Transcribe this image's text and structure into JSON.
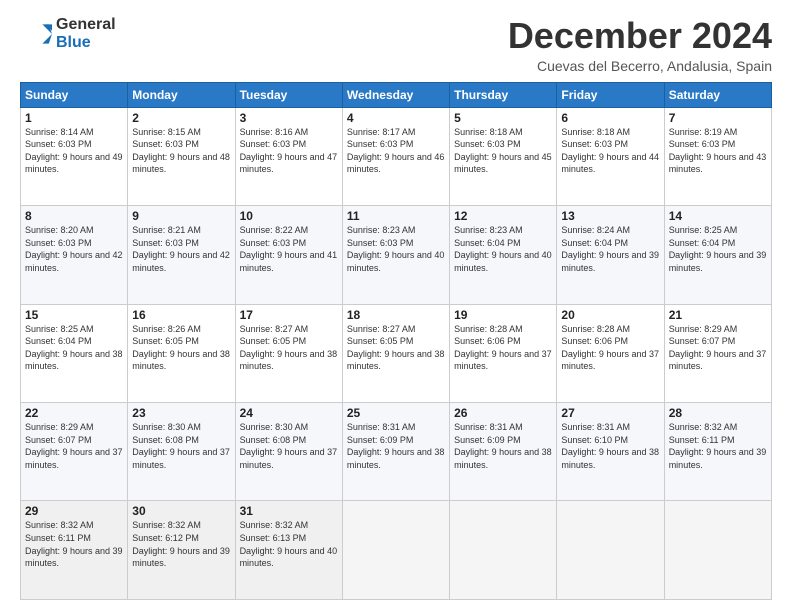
{
  "logo": {
    "general": "General",
    "blue": "Blue"
  },
  "title": "December 2024",
  "subtitle": "Cuevas del Becerro, Andalusia, Spain",
  "days_header": [
    "Sunday",
    "Monday",
    "Tuesday",
    "Wednesday",
    "Thursday",
    "Friday",
    "Saturday"
  ],
  "weeks": [
    [
      {
        "day": "1",
        "sunrise": "8:14 AM",
        "sunset": "6:03 PM",
        "daylight": "9 hours and 49 minutes."
      },
      {
        "day": "2",
        "sunrise": "8:15 AM",
        "sunset": "6:03 PM",
        "daylight": "9 hours and 48 minutes."
      },
      {
        "day": "3",
        "sunrise": "8:16 AM",
        "sunset": "6:03 PM",
        "daylight": "9 hours and 47 minutes."
      },
      {
        "day": "4",
        "sunrise": "8:17 AM",
        "sunset": "6:03 PM",
        "daylight": "9 hours and 46 minutes."
      },
      {
        "day": "5",
        "sunrise": "8:18 AM",
        "sunset": "6:03 PM",
        "daylight": "9 hours and 45 minutes."
      },
      {
        "day": "6",
        "sunrise": "8:18 AM",
        "sunset": "6:03 PM",
        "daylight": "9 hours and 44 minutes."
      },
      {
        "day": "7",
        "sunrise": "8:19 AM",
        "sunset": "6:03 PM",
        "daylight": "9 hours and 43 minutes."
      }
    ],
    [
      {
        "day": "8",
        "sunrise": "8:20 AM",
        "sunset": "6:03 PM",
        "daylight": "9 hours and 42 minutes."
      },
      {
        "day": "9",
        "sunrise": "8:21 AM",
        "sunset": "6:03 PM",
        "daylight": "9 hours and 42 minutes."
      },
      {
        "day": "10",
        "sunrise": "8:22 AM",
        "sunset": "6:03 PM",
        "daylight": "9 hours and 41 minutes."
      },
      {
        "day": "11",
        "sunrise": "8:23 AM",
        "sunset": "6:03 PM",
        "daylight": "9 hours and 40 minutes."
      },
      {
        "day": "12",
        "sunrise": "8:23 AM",
        "sunset": "6:04 PM",
        "daylight": "9 hours and 40 minutes."
      },
      {
        "day": "13",
        "sunrise": "8:24 AM",
        "sunset": "6:04 PM",
        "daylight": "9 hours and 39 minutes."
      },
      {
        "day": "14",
        "sunrise": "8:25 AM",
        "sunset": "6:04 PM",
        "daylight": "9 hours and 39 minutes."
      }
    ],
    [
      {
        "day": "15",
        "sunrise": "8:25 AM",
        "sunset": "6:04 PM",
        "daylight": "9 hours and 38 minutes."
      },
      {
        "day": "16",
        "sunrise": "8:26 AM",
        "sunset": "6:05 PM",
        "daylight": "9 hours and 38 minutes."
      },
      {
        "day": "17",
        "sunrise": "8:27 AM",
        "sunset": "6:05 PM",
        "daylight": "9 hours and 38 minutes."
      },
      {
        "day": "18",
        "sunrise": "8:27 AM",
        "sunset": "6:05 PM",
        "daylight": "9 hours and 38 minutes."
      },
      {
        "day": "19",
        "sunrise": "8:28 AM",
        "sunset": "6:06 PM",
        "daylight": "9 hours and 37 minutes."
      },
      {
        "day": "20",
        "sunrise": "8:28 AM",
        "sunset": "6:06 PM",
        "daylight": "9 hours and 37 minutes."
      },
      {
        "day": "21",
        "sunrise": "8:29 AM",
        "sunset": "6:07 PM",
        "daylight": "9 hours and 37 minutes."
      }
    ],
    [
      {
        "day": "22",
        "sunrise": "8:29 AM",
        "sunset": "6:07 PM",
        "daylight": "9 hours and 37 minutes."
      },
      {
        "day": "23",
        "sunrise": "8:30 AM",
        "sunset": "6:08 PM",
        "daylight": "9 hours and 37 minutes."
      },
      {
        "day": "24",
        "sunrise": "8:30 AM",
        "sunset": "6:08 PM",
        "daylight": "9 hours and 37 minutes."
      },
      {
        "day": "25",
        "sunrise": "8:31 AM",
        "sunset": "6:09 PM",
        "daylight": "9 hours and 38 minutes."
      },
      {
        "day": "26",
        "sunrise": "8:31 AM",
        "sunset": "6:09 PM",
        "daylight": "9 hours and 38 minutes."
      },
      {
        "day": "27",
        "sunrise": "8:31 AM",
        "sunset": "6:10 PM",
        "daylight": "9 hours and 38 minutes."
      },
      {
        "day": "28",
        "sunrise": "8:32 AM",
        "sunset": "6:11 PM",
        "daylight": "9 hours and 39 minutes."
      }
    ],
    [
      {
        "day": "29",
        "sunrise": "8:32 AM",
        "sunset": "6:11 PM",
        "daylight": "9 hours and 39 minutes."
      },
      {
        "day": "30",
        "sunrise": "8:32 AM",
        "sunset": "6:12 PM",
        "daylight": "9 hours and 39 minutes."
      },
      {
        "day": "31",
        "sunrise": "8:32 AM",
        "sunset": "6:13 PM",
        "daylight": "9 hours and 40 minutes."
      },
      null,
      null,
      null,
      null
    ]
  ]
}
